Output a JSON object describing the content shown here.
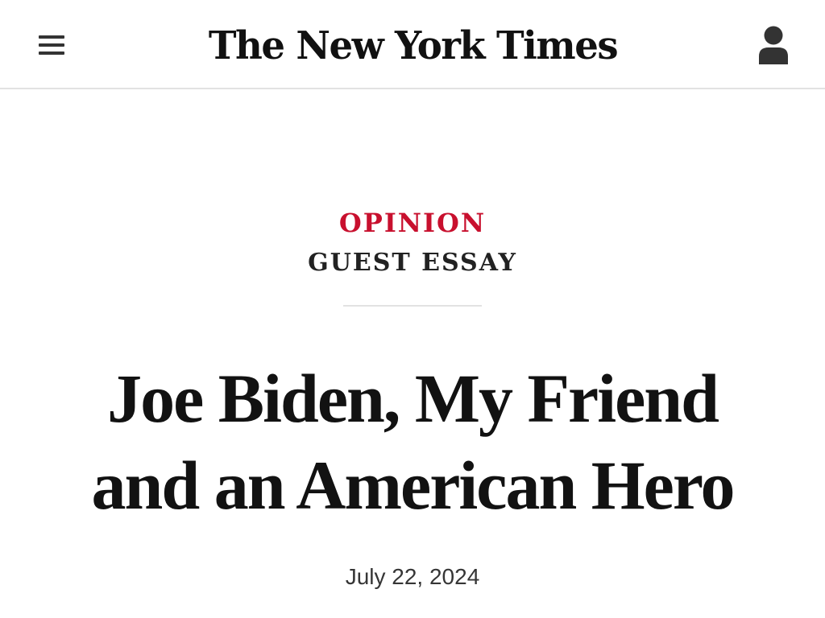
{
  "header": {
    "logo_text": "The New York Times",
    "menu_icon": "hamburger-menu-icon",
    "account_icon": "user-account-icon"
  },
  "article": {
    "section": "OPINION",
    "label": "GUEST ESSAY",
    "headline": "Joe Biden, My Friend and an American Hero",
    "date": "July 22, 2024"
  },
  "colors": {
    "section": "#c8102e",
    "text": "#121212",
    "divider": "#e2e2e2",
    "icon": "#333333"
  }
}
